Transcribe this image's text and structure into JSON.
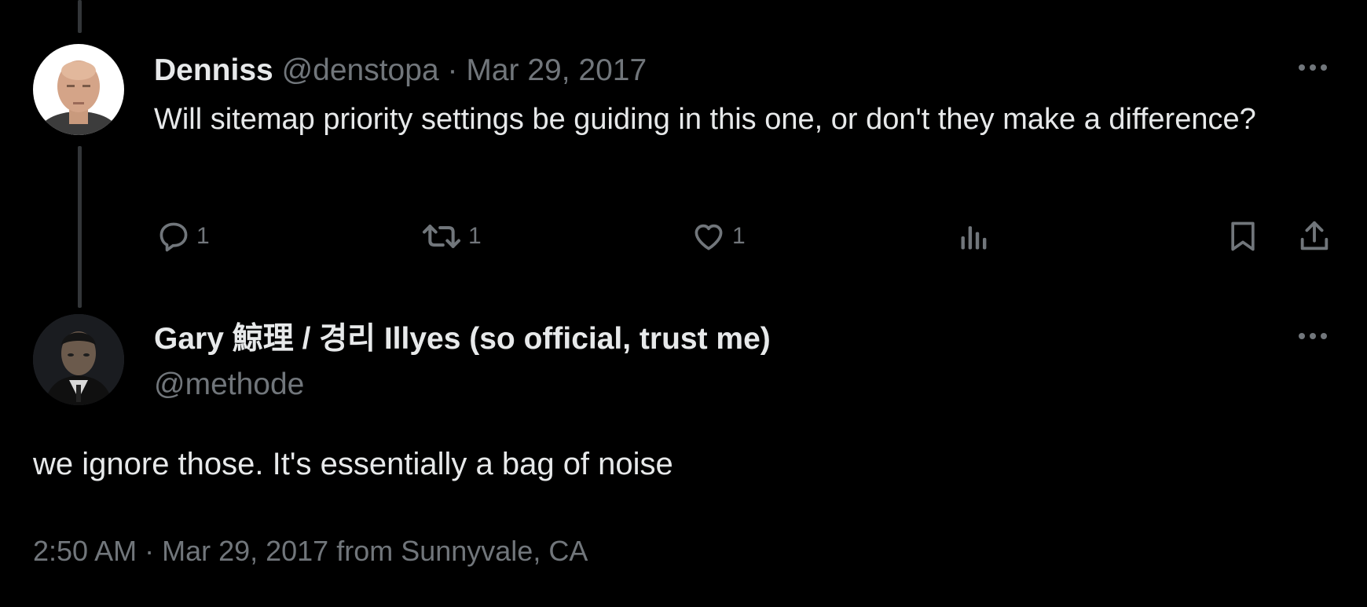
{
  "first_tweet": {
    "display_name": "Denniss",
    "handle": "@denstopa",
    "separator": "·",
    "date": "Mar 29, 2017",
    "text": "Will sitemap priority settings be guiding in this one, or don't they make a difference?",
    "actions": {
      "reply_count": "1",
      "retweet_count": "1",
      "like_count": "1"
    }
  },
  "main_tweet": {
    "display_name": "Gary 鯨理 / 경리 Illyes (so official, trust me)",
    "handle": "@methode",
    "text": "we ignore those. It's essentially a bag of noise",
    "timestamp": "2:50 AM · Mar 29, 2017 from Sunnyvale, CA"
  },
  "icons": {
    "more": "more-horizontal-icon",
    "reply": "reply-icon",
    "retweet": "retweet-icon",
    "like": "heart-icon",
    "views": "views-icon",
    "bookmark": "bookmark-icon",
    "share": "share-icon"
  },
  "colors": {
    "background": "#000000",
    "primary_text": "#e7e9ea",
    "secondary_text": "#71767b",
    "thread_line": "#333639"
  }
}
